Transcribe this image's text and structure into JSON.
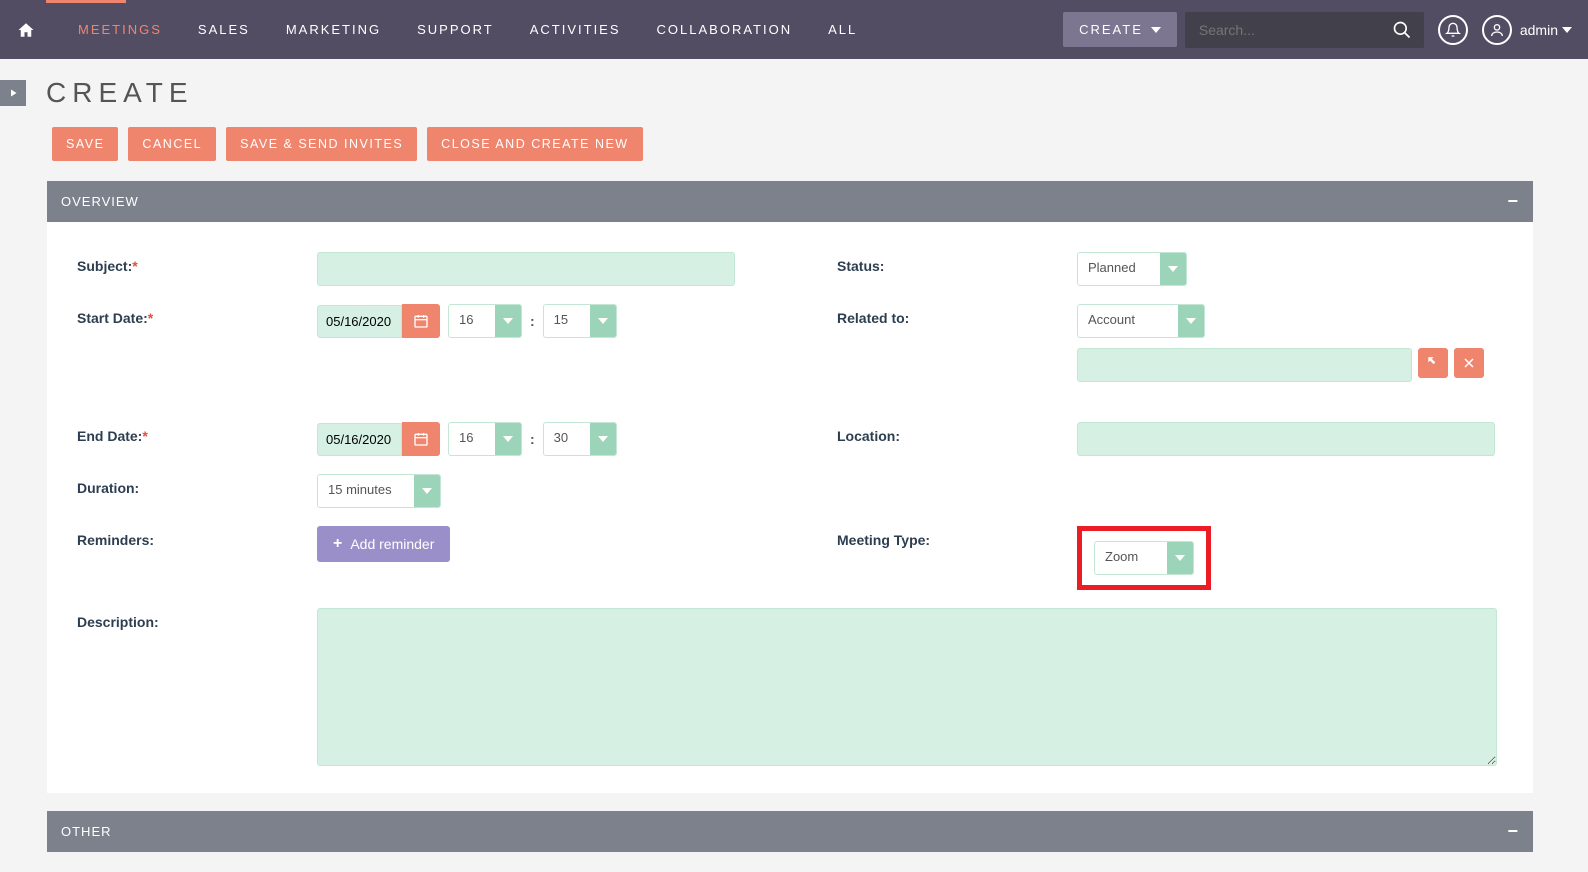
{
  "nav": {
    "items": [
      "MEETINGS",
      "SALES",
      "MARKETING",
      "SUPPORT",
      "ACTIVITIES",
      "COLLABORATION",
      "ALL"
    ],
    "create_btn": "CREATE",
    "search_placeholder": "Search...",
    "user": "admin"
  },
  "page": {
    "title": "CREATE"
  },
  "buttons": {
    "save": "SAVE",
    "cancel": "CANCEL",
    "save_send": "SAVE & SEND INVITES",
    "close_new": "CLOSE AND CREATE NEW"
  },
  "panels": {
    "overview": "OVERVIEW",
    "other": "OTHER"
  },
  "form": {
    "subject_label": "Subject:",
    "start_date_label": "Start Date:",
    "end_date_label": "End Date:",
    "duration_label": "Duration:",
    "reminders_label": "Reminders:",
    "description_label": "Description:",
    "status_label": "Status:",
    "related_to_label": "Related to:",
    "location_label": "Location:",
    "meeting_type_label": "Meeting Type:",
    "start_date": "05/16/2020",
    "start_hour": "16",
    "start_min": "15",
    "end_date": "05/16/2020",
    "end_hour": "16",
    "end_min": "30",
    "duration": "15 minutes",
    "add_reminder": "Add reminder",
    "status": "Planned",
    "related_to": "Account",
    "meeting_type": "Zoom"
  }
}
